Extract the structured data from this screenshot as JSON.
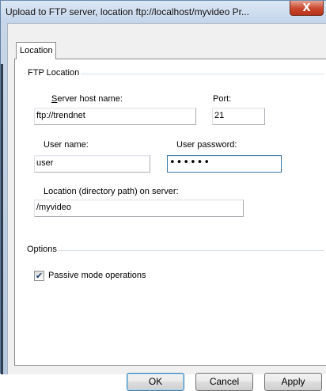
{
  "window": {
    "title": "Upload to FTP server, location ftp://localhost/myvideo Pr...",
    "close_glyph": "X"
  },
  "tabs": [
    {
      "label": "Location"
    }
  ],
  "ftp_location": {
    "group_title": "FTP Location",
    "server_host_label": "Server host name:",
    "server_host_value": "ftp://trendnet",
    "port_label": "Port:",
    "port_value": "21",
    "user_name_label": "User name:",
    "user_name_value": "user",
    "password_label": "User password:",
    "password_value": "••••••",
    "directory_label": "Location (directory path) on server:",
    "directory_value": "/myvideo"
  },
  "options": {
    "group_title": "Options",
    "passive_mode_label": "Passive mode operations",
    "passive_mode_checked": true,
    "check_glyph": "✔"
  },
  "buttons": {
    "ok": "OK",
    "cancel": "Cancel",
    "apply": "Apply"
  }
}
